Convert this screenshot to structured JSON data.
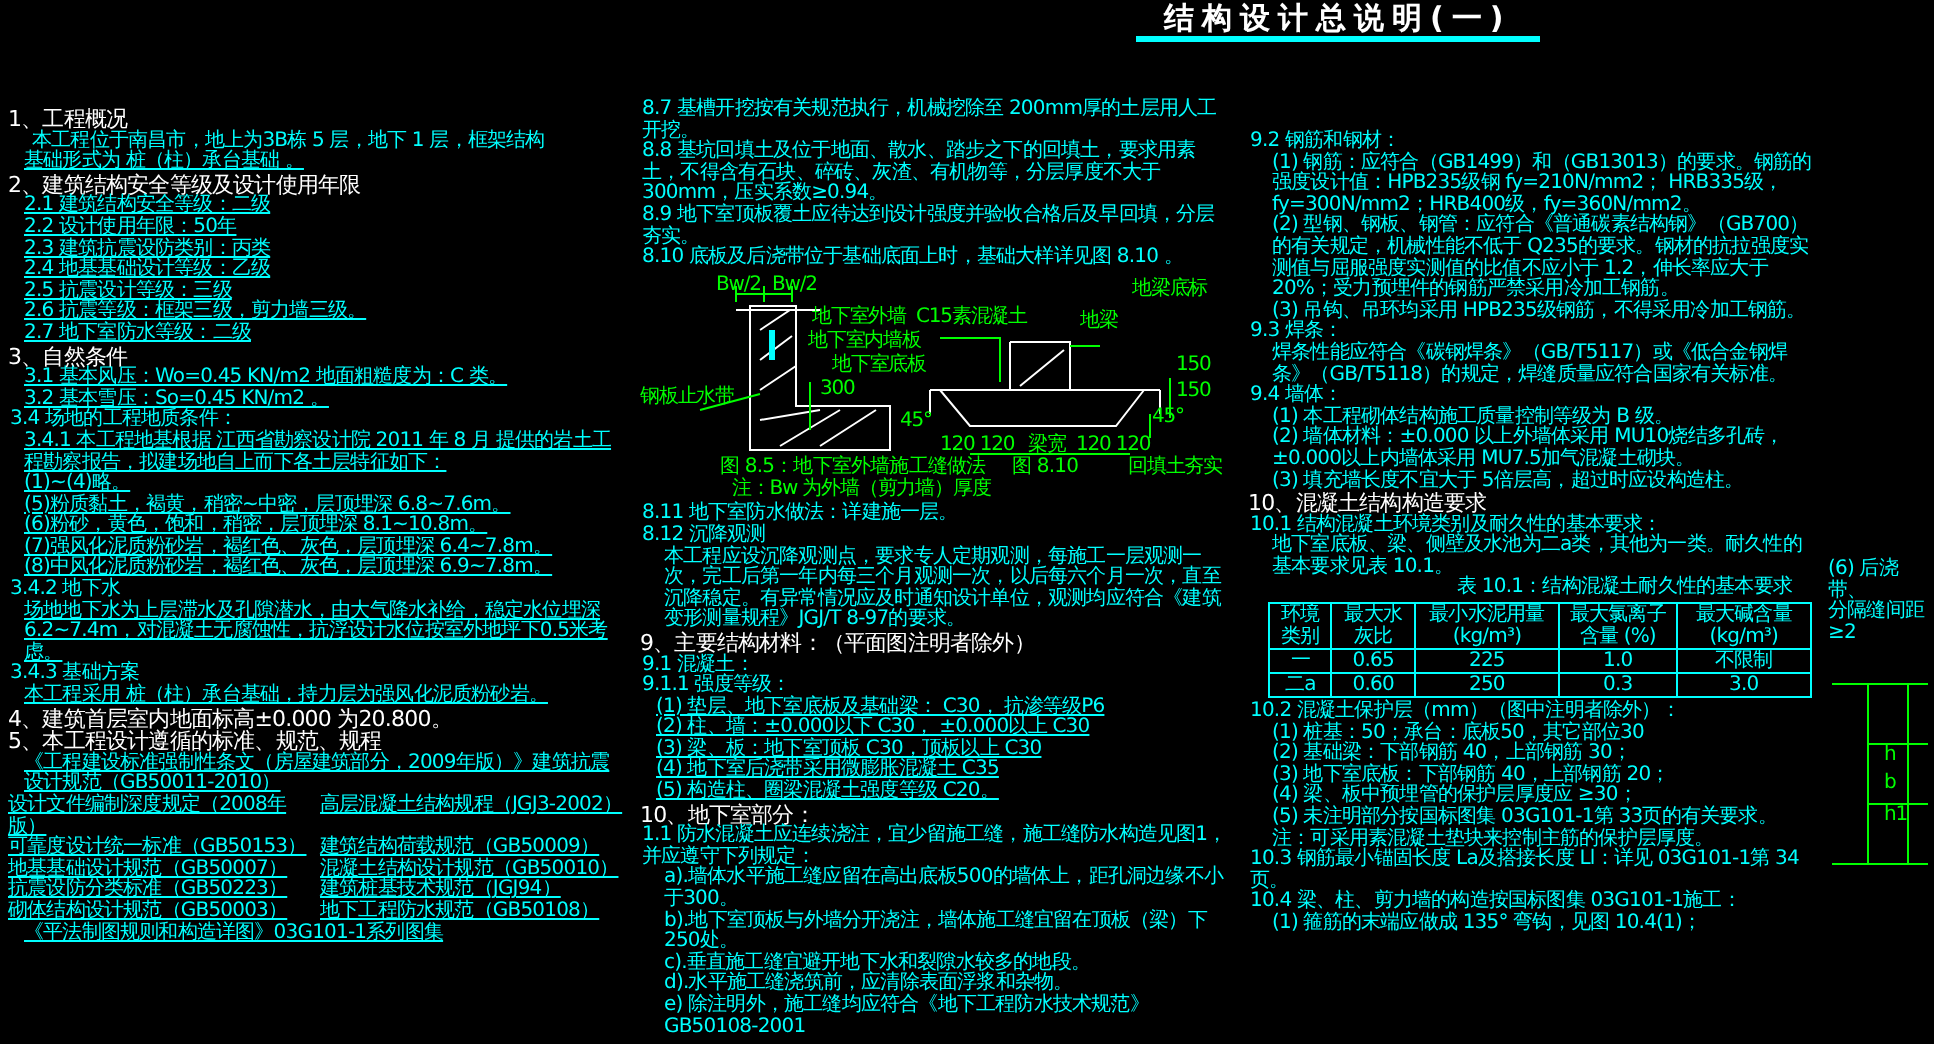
{
  "title": "结构设计总说明(一)",
  "left": [
    {
      "kind": "heading",
      "text": "1、工程概况"
    },
    {
      "kind": "para",
      "text": "本工程位于南昌市，地上为3B栋 5 层，地下 1 层，框架结构"
    },
    {
      "kind": "filled",
      "text": "基础形式为 桩（柱）承台基础 。"
    },
    {
      "kind": "heading",
      "text": "2、建筑结构安全等级及设计使用年限"
    },
    {
      "kind": "filled",
      "text": "2.1 建筑结构安全等级：二级"
    },
    {
      "kind": "filled",
      "text": "2.2 设计使用年限：50年"
    },
    {
      "kind": "filled",
      "text": "2.3 建筑抗震设防类别：丙类"
    },
    {
      "kind": "filled",
      "text": "2.4 地基基础设计等级：乙级"
    },
    {
      "kind": "filled",
      "text": "2.5 抗震设计等级：三级"
    },
    {
      "kind": "filled",
      "text": "2.6 抗震等级：框架三级，剪力墙三级。"
    },
    {
      "kind": "filled",
      "text": "2.7 地下室防水等级：二级"
    },
    {
      "kind": "heading",
      "text": "3、自然条件"
    },
    {
      "kind": "filled",
      "text": "3.1 基本风压：Wo=0.45 KN/m2  地面粗糙度为：C 类。"
    },
    {
      "kind": "filled",
      "text": "3.2 基本雪压：So=0.45 KN/m2 。"
    },
    {
      "kind": "line",
      "text": "3.4 场地的工程地质条件："
    },
    {
      "kind": "filled",
      "text": "3.4.1 本工程地基根据 江西省勘察设计院 2011 年 8 月 提供的岩土工程勘察报告，拟建场地自上而下各土层特征如下："
    },
    {
      "kind": "filled",
      "text": "(1)~(4)略。"
    },
    {
      "kind": "filled",
      "text": "(5)粉质黏土，褐黄，稍密~中密，层顶埋深 6.8~7.6m。"
    },
    {
      "kind": "filled",
      "text": "(6)粉砂，黄色，饱和，稍密，层顶埋深 8.1~10.8m。"
    },
    {
      "kind": "filled",
      "text": "(7)强风化泥质粉砂岩，褐红色、灰色，层顶埋深 6.4~7.8m。"
    },
    {
      "kind": "filled",
      "text": "(8)中风化泥质粉砂岩，褐红色、灰色，层顶埋深 6.9~7.8m。"
    },
    {
      "kind": "line",
      "text": "3.4.2 地下水"
    },
    {
      "kind": "filled",
      "text": "场地地下水为上层滞水及孔隙潜水，由大气降水补给，稳定水位埋深 6.2~7.4m，对混凝土无腐蚀性，抗浮设计水位按室外地坪下0.5米考虑。"
    },
    {
      "kind": "line",
      "text": "3.4.3 基础方案"
    },
    {
      "kind": "filled",
      "text": "本工程采用 桩（柱）承台基础，持力层为强风化泥质粉砂岩。"
    },
    {
      "kind": "heading",
      "text": "4、建筑首层室内地面标高±0.000 为20.800。"
    },
    {
      "kind": "heading",
      "text": "5、本工程设计遵循的标准、规范、规程"
    },
    {
      "kind": "filled",
      "text": "《工程建设标准强制性条文（房屋建筑部分，2009年版）》建筑抗震设计规范（GB50011-2010）"
    },
    {
      "kind": "pair",
      "text": "设计文件编制深度规定（2008年版）",
      "text2": "高层混凝土结构规程（JGJ3-2002）"
    },
    {
      "kind": "pair",
      "text": "可靠度设计统一标准（GB50153）",
      "text2": "建筑结构荷载规范（GB50009）"
    },
    {
      "kind": "pair",
      "text": "地基基础设计规范（GB50007）",
      "text2": "混凝土结构设计规范（GB50010）"
    },
    {
      "kind": "pair",
      "text": "抗震设防分类标准（GB50223）",
      "text2": "建筑桩基技术规范（JGJ94）"
    },
    {
      "kind": "pair",
      "text": "砌体结构设计规范（GB50003）",
      "text2": "地下工程防水规范（GB50108）"
    },
    {
      "kind": "filled",
      "text": "《平法制图规则和构造详图》03G101-1系列图集"
    }
  ],
  "middle_top": [
    {
      "kind": "line",
      "text": "8.7 基槽开挖按有关规范执行，机械挖除至 200mm厚的土层用人工开挖。"
    },
    {
      "kind": "line",
      "text": "8.8 基坑回填土及位于地面、散水、踏步之下的回填土，要求用素土，不得含有石块、碎砖、灰渣、有机物等，分层厚度不大于 300mm，压实系数≥0.94。"
    },
    {
      "kind": "line",
      "text": "8.9 地下室顶板覆土应待达到设计强度并验收合格后及早回填，分层夯实。"
    },
    {
      "kind": "line",
      "text": "8.10 底板及后浇带位于基础底面上时，基础大样详见图 8.10 。"
    }
  ],
  "figure_a": {
    "labels": [
      "Bw/2",
      "Bw/2",
      "地下室外墙",
      "地下室内墙板",
      "地下室底板",
      "300",
      "钢板止水带"
    ],
    "caption": "图 8.5：地下室外墙施工缝做法",
    "note": "注：Bw 为外墙（剪力墙）厚度"
  },
  "figure_b": {
    "labels": [
      "地梁底标",
      "C15素混凝土",
      "地梁",
      "150",
      "150",
      "45°",
      "45°",
      "120 120",
      "梁宽",
      "120 120",
      "回填土夯实"
    ],
    "caption": "图 8.10"
  },
  "middle_bottom": [
    {
      "kind": "line",
      "text": "8.11 地下室防水做法：详建施一层。"
    },
    {
      "kind": "line",
      "text": "8.12 沉降观测"
    },
    {
      "kind": "para",
      "text": "本工程应设沉降观测点，要求专人定期观测，每施工一层观测一次，完工后第一年内每三个月观测一次，以后每六个月一次，直至沉降稳定。有异常情况应及时通知设计单位，观测均应符合《建筑变形测量规程》JGJ/T 8-97的要求。"
    },
    {
      "kind": "heading",
      "text": "9、主要结构材料：（平面图注明者除外）"
    },
    {
      "kind": "line",
      "text": "9.1 混凝土："
    },
    {
      "kind": "line",
      "text": "9.1.1 强度等级："
    },
    {
      "kind": "filled",
      "text": "(1) 垫层、地下室底板及基础梁： C30， 抗渗等级P6"
    },
    {
      "kind": "filled",
      "text": "(2) 柱、墙：±0.000以下 C30， ±0.000以上 C30"
    },
    {
      "kind": "filled",
      "text": "(3) 梁、板：地下室顶板 C30，顶板以上 C30"
    },
    {
      "kind": "filled",
      "text": "(4) 地下室后浇带采用微膨胀混凝土 C35"
    },
    {
      "kind": "filled",
      "text": "(5) 构造柱、圈梁混凝土强度等级 C20。"
    },
    {
      "kind": "heading",
      "text": "10、地下室部分："
    },
    {
      "kind": "line",
      "text": "1.1 防水混凝土应连续浇注，宜少留施工缝，施工缝防水构造见图1，并应遵守下列规定："
    },
    {
      "kind": "para",
      "text": "a).墙体水平施工缝应留在高出底板500的墙体上，距孔洞边缘不小于300。"
    },
    {
      "kind": "para",
      "text": "b).地下室顶板与外墙分开浇注，墙体施工缝宜留在顶板（梁）下250处。"
    },
    {
      "kind": "para",
      "text": "c).垂直施工缝宜避开地下水和裂隙水较多的地段。"
    },
    {
      "kind": "para",
      "text": "d).水平施工缝浇筑前，应清除表面浮浆和杂物。"
    },
    {
      "kind": "para",
      "text": "e) 除注明外，施工缝均应符合《地下工程防水技术规范》GB50108-2001"
    }
  ],
  "right_top": [
    {
      "kind": "line",
      "text": "9.2 钢筋和钢材："
    },
    {
      "kind": "para",
      "text": "(1) 钢筋：应符合（GB1499）和（GB13013）的要求。钢筋的强度设计值：HPB235级钢 fy=210N/mm2； HRB335级，fy=300N/mm2；HRB400级，fy=360N/mm2。"
    },
    {
      "kind": "para",
      "text": "(2) 型钢、钢板、钢管：应符合《普通碳素结构钢》（GB700）的有关规定，机械性能不低于 Q235的要求。钢材的抗拉强度实测值与屈服强度实测值的比值不应小于 1.2，伸长率应大于 20%；受力预埋件的钢筋严禁采用冷加工钢筋。"
    },
    {
      "kind": "para",
      "text": "(3) 吊钩、吊环均采用 HPB235级钢筋，不得采用冷加工钢筋。"
    },
    {
      "kind": "line",
      "text": "9.3 焊条："
    },
    {
      "kind": "para",
      "text": "焊条性能应符合《碳钢焊条》（GB/T5117）或《低合金钢焊条》（GB/T5118）的规定，焊缝质量应符合国家有关标准。"
    },
    {
      "kind": "line",
      "text": "9.4 墙体："
    },
    {
      "kind": "para",
      "text": "(1) 本工程砌体结构施工质量控制等级为 B 级。"
    },
    {
      "kind": "para",
      "text": "(2) 墙体材料：±0.000 以上外墙体采用 MU10烧结多孔砖，±0.000以上内墙体采用 MU7.5加气混凝土砌块。"
    },
    {
      "kind": "para",
      "text": "(3) 填充墙长度不宜大于 5倍层高，超过时应设构造柱。"
    },
    {
      "kind": "heading",
      "text": "10、混凝土结构构造要求"
    },
    {
      "kind": "line",
      "text": "10.1 结构混凝土环境类别及耐久性的基本要求："
    },
    {
      "kind": "para",
      "text": "地下室底板、梁、侧壁及水池为二a类，其他为一类。耐久性的基本要求见表 10.1。"
    }
  ],
  "table": {
    "caption": "表 10.1：结构混凝土耐久性的基本要求",
    "columns": [
      "环境类别",
      "最大水灰比",
      "最小水泥用量 (kg/m³)",
      "最大氯离子含量 (%)",
      "最大碱含量 (kg/m³)"
    ],
    "rows": [
      [
        "一",
        "0.65",
        "225",
        "1.0",
        "不限制"
      ],
      [
        "二a",
        "0.60",
        "250",
        "0.3",
        "3.0"
      ]
    ]
  },
  "right_bottom": [
    {
      "kind": "line",
      "text": "10.2 混凝土保护层（mm）（图中注明者除外）："
    },
    {
      "kind": "para",
      "text": "(1) 桩基：50；承台：底板50，其它部位30"
    },
    {
      "kind": "para",
      "text": "(2) 基础梁：下部钢筋 40，上部钢筋 30；"
    },
    {
      "kind": "para",
      "text": "(3) 地下室底板：下部钢筋 40，上部钢筋 20；"
    },
    {
      "kind": "para",
      "text": "(4) 梁、板中预埋管的保护层厚度应 ≥30；"
    },
    {
      "kind": "para",
      "text": "(5) 未注明部分按国标图集 03G101-1第 33页的有关要求。"
    },
    {
      "kind": "para",
      "text": "注：可采用素混凝土垫块来控制主筋的保护层厚度。"
    },
    {
      "kind": "line",
      "text": "10.3 钢筋最小锚固长度 La及搭接长度 Ll：详见 03G101-1第 34页。"
    },
    {
      "kind": "line",
      "text": "10.4 梁、柱、剪力墙的构造按国标图集 03G101-1施工："
    },
    {
      "kind": "para",
      "text": "(1) 箍筋的末端应做成 135° 弯钩，见图 10.4(1)；"
    }
  ],
  "side": {
    "texts": [
      "(6) 后浇带、",
      "分隔缝间距 ≥2"
    ],
    "labels": [
      "h",
      "b",
      "h1"
    ]
  }
}
